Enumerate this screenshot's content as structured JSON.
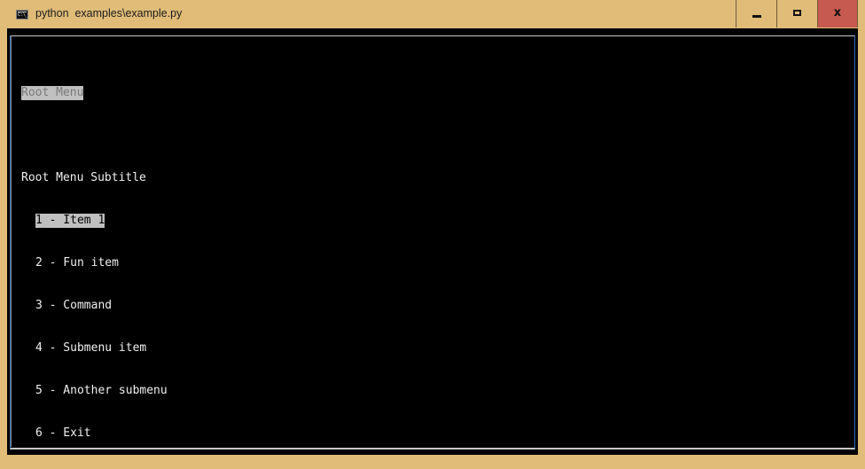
{
  "window": {
    "title": "python  examples\\example.py",
    "icon": "console-icon",
    "icon_text": "C:\\_",
    "controls": {
      "minimize": "minimize-icon",
      "maximize": "maximize-icon",
      "close": "close-icon",
      "close_glyph": "x"
    },
    "colors": {
      "frame": "#e0bc78",
      "close_button": "#c75a50",
      "console_bg": "#000000",
      "console_fg": "#f0f0f0",
      "highlight_bg": "#c0c0c0"
    }
  },
  "console": {
    "menu_title": "Root Menu",
    "menu_subtitle": "Root Menu Subtitle",
    "items": [
      {
        "label": "1 - Item 1",
        "selected": true
      },
      {
        "label": "2 - Fun item",
        "selected": false
      },
      {
        "label": "3 - Command",
        "selected": false
      },
      {
        "label": "4 - Submenu item",
        "selected": false
      },
      {
        "label": "5 - Another submenu",
        "selected": false
      },
      {
        "label": "6 - Exit",
        "selected": false
      }
    ]
  }
}
